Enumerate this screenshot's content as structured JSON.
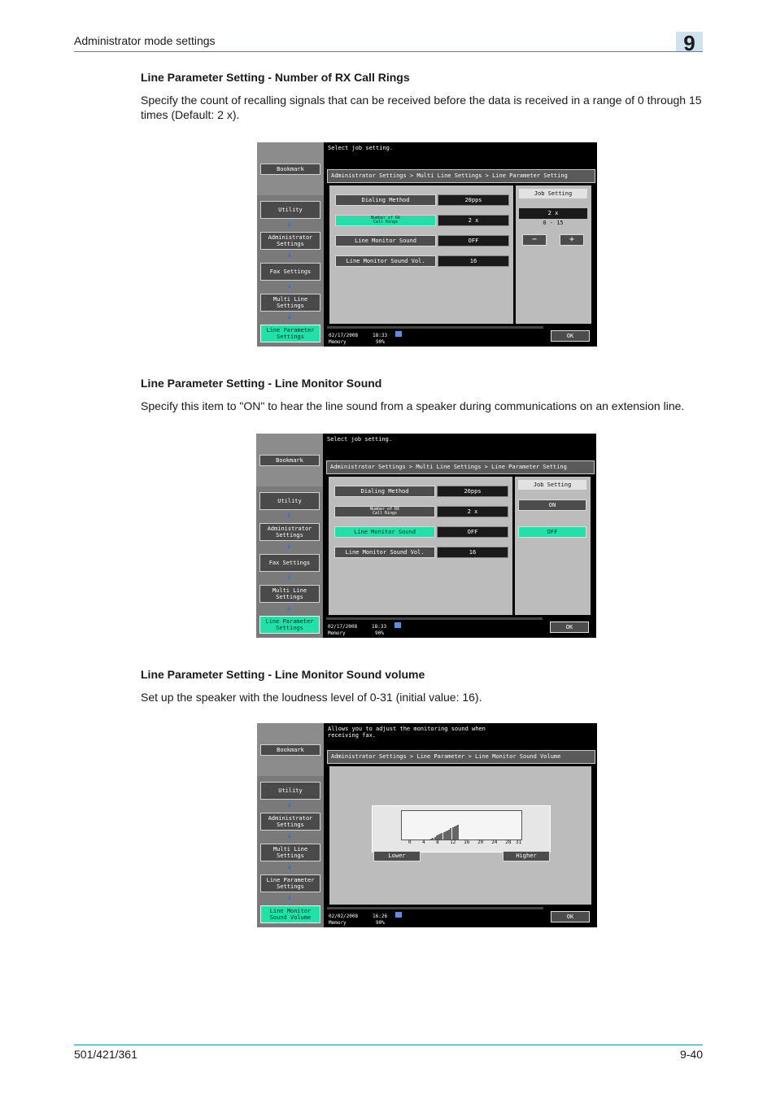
{
  "header": {
    "title": "Administrator mode settings",
    "chapter": "9"
  },
  "sections": [
    {
      "heading": "Line Parameter Setting - Number of RX Call Rings",
      "text": "Specify the count of recalling signals that can be received before the data is received in a range of 0 through 15 times (Default: 2 x)."
    },
    {
      "heading": "Line Parameter Setting - Line Monitor Sound",
      "text": "Specify this item to \"ON\" to hear the line sound from a speaker during communications on an extension line."
    },
    {
      "heading": "Line Parameter Setting - Line Monitor Sound volume",
      "text": "Set up the speaker with the loudness level of 0-31 (initial value: 16)."
    }
  ],
  "screen1": {
    "message": "Select job setting.",
    "breadcrumb": "Administrator Settings > Multi Line Settings > Line Parameter Setting",
    "sidebar": {
      "bookmark": "Bookmark",
      "utility": "Utility",
      "admin": "Administrator\nSettings",
      "fax": "Fax Settings",
      "multi": "Multi Line\nSettings",
      "line_param": "Line Parameter\nSettings"
    },
    "rows": [
      {
        "label": "Dialing Method",
        "value": "20pps"
      },
      {
        "label": "Number of RX\nCall Rings",
        "value": "2  x"
      },
      {
        "label": "Line Monitor Sound",
        "value": "OFF"
      },
      {
        "label": "Line Monitor Sound Vol.",
        "value": "16"
      }
    ],
    "job_setting": "Job Setting",
    "job_value": "2  x",
    "job_range": "0  -  15",
    "minus": "−",
    "plus": "+",
    "date": "02/17/2008",
    "time": "18:33",
    "memory": "Memory",
    "memory_pct": "90%",
    "ok": "OK"
  },
  "screen2": {
    "message": "Select job setting.",
    "breadcrumb": "Administrator Settings > Multi Line Settings > Line Parameter Setting",
    "sidebar": {
      "bookmark": "Bookmark",
      "utility": "Utility",
      "admin": "Administrator\nSettings",
      "fax": "Fax Settings",
      "multi": "Multi Line\nSettings",
      "line_param": "Line Parameter\nSettings"
    },
    "rows": [
      {
        "label": "Dialing Method",
        "value": "20pps"
      },
      {
        "label": "Number of RX\nCall Rings",
        "value": "2  x"
      },
      {
        "label": "Line Monitor Sound",
        "value": "OFF"
      },
      {
        "label": "Line Monitor Sound Vol.",
        "value": "16"
      }
    ],
    "job_setting": "Job Setting",
    "on": "ON",
    "off": "OFF",
    "date": "02/17/2008",
    "time": "18:33",
    "memory": "Memory",
    "memory_pct": "90%",
    "ok": "OK"
  },
  "screen3": {
    "message": "Allows you to adjust the monitoring sound when\nreceiving fax.",
    "breadcrumb": "Administrator Settings  > Line Parameter  > Line Monitor Sound Volume",
    "sidebar": {
      "bookmark": "Bookmark",
      "utility": "Utility",
      "admin": "Administrator\nSettings",
      "multi": "Multi Line\nSettings",
      "line_param": "Line Parameter\nSettings",
      "volume": "Line Monitor\nSound Volume"
    },
    "ticks": [
      "0",
      "4",
      "8",
      "12",
      "16",
      "20",
      "24",
      "28",
      "31"
    ],
    "level": 16,
    "max_level": 31,
    "lower": "Lower",
    "higher": "Higher",
    "date": "02/02/2008",
    "time": "16:26",
    "memory": "Memory",
    "memory_pct": "90%",
    "ok": "OK"
  },
  "footer": {
    "model": "501/421/361",
    "page": "9-40"
  },
  "colors": {
    "accent": "#1f9ab8",
    "active_button": "#22e0a8"
  }
}
